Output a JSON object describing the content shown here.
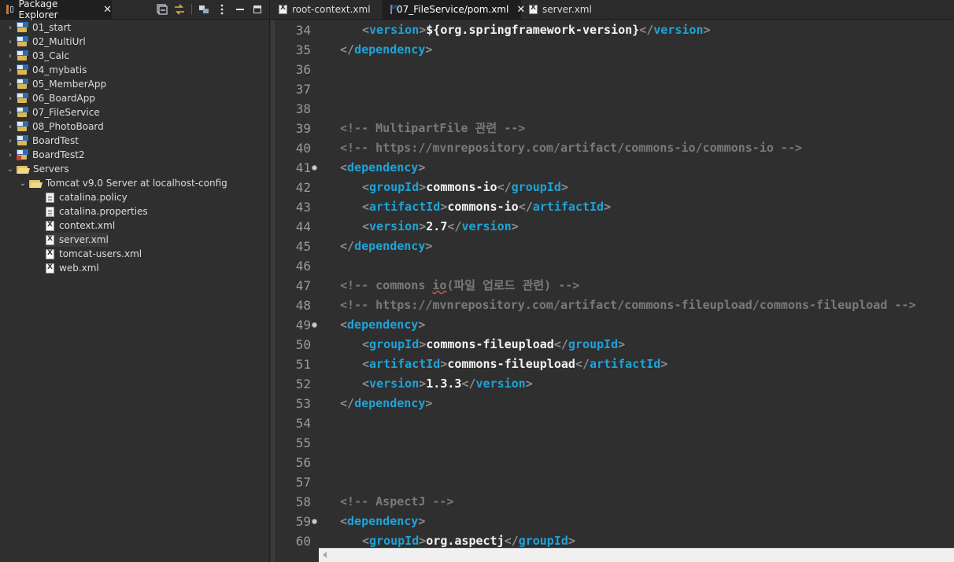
{
  "left_panel": {
    "view_title": "Package Explorer",
    "tree": [
      {
        "label": "01_start",
        "kind": "project"
      },
      {
        "label": "02_MultiUrl",
        "kind": "project"
      },
      {
        "label": "03_Calc",
        "kind": "project"
      },
      {
        "label": "04_mybatis",
        "kind": "project"
      },
      {
        "label": "05_MemberApp",
        "kind": "project"
      },
      {
        "label": "06_BoardApp",
        "kind": "project"
      },
      {
        "label": "07_FileService",
        "kind": "project"
      },
      {
        "label": "08_PhotoBoard",
        "kind": "project"
      },
      {
        "label": "BoardTest",
        "kind": "project"
      },
      {
        "label": "BoardTest2",
        "kind": "project-error"
      },
      {
        "label": "Servers",
        "kind": "folder"
      },
      {
        "label": "Tomcat v9.0 Server at localhost-config",
        "kind": "folder"
      },
      {
        "label": "catalina.policy",
        "kind": "file"
      },
      {
        "label": "catalina.properties",
        "kind": "file"
      },
      {
        "label": "context.xml",
        "kind": "xml"
      },
      {
        "label": "server.xml",
        "kind": "xml",
        "selected": true
      },
      {
        "label": "tomcat-users.xml",
        "kind": "xml"
      },
      {
        "label": "web.xml",
        "kind": "xml"
      }
    ]
  },
  "editor": {
    "tabs": [
      {
        "label": "root-context.xml",
        "icon": "xml-file-icon",
        "active": false
      },
      {
        "label": "07_FileService/pom.xml",
        "icon": "maven-pom-icon",
        "active": true
      },
      {
        "label": "server.xml",
        "icon": "xml-file-icon",
        "active": false
      }
    ],
    "lines": [
      {
        "num": "34",
        "fold": false,
        "indent": 4,
        "tokens": [
          {
            "t": "<",
            "c": "br"
          },
          {
            "t": "version",
            "c": "tag"
          },
          {
            "t": ">",
            "c": "br"
          },
          {
            "t": "${org.springframework-version}",
            "c": "text"
          },
          {
            "t": "</",
            "c": "br"
          },
          {
            "t": "version",
            "c": "tag"
          },
          {
            "t": ">",
            "c": "br"
          }
        ]
      },
      {
        "num": "35",
        "fold": false,
        "indent": 2,
        "tokens": [
          {
            "t": "</",
            "c": "br"
          },
          {
            "t": "dependency",
            "c": "tag"
          },
          {
            "t": ">",
            "c": "br"
          }
        ]
      },
      {
        "num": "36",
        "fold": false,
        "indent": 0,
        "tokens": []
      },
      {
        "num": "37",
        "fold": false,
        "indent": 0,
        "tokens": []
      },
      {
        "num": "38",
        "fold": false,
        "indent": 0,
        "tokens": []
      },
      {
        "num": "39",
        "fold": false,
        "indent": 2,
        "tokens": [
          {
            "t": "<!-- MultipartFile 관련 -->",
            "c": "comment"
          }
        ]
      },
      {
        "num": "40",
        "fold": false,
        "indent": 2,
        "tokens": [
          {
            "t": "<!-- https://mvnrepository.com/artifact/commons-io/commons-io -->",
            "c": "comment"
          }
        ]
      },
      {
        "num": "41",
        "fold": true,
        "indent": 2,
        "tokens": [
          {
            "t": "<",
            "c": "br"
          },
          {
            "t": "dependency",
            "c": "tag"
          },
          {
            "t": ">",
            "c": "br"
          }
        ]
      },
      {
        "num": "42",
        "fold": false,
        "indent": 4,
        "tokens": [
          {
            "t": "<",
            "c": "br"
          },
          {
            "t": "groupId",
            "c": "tag"
          },
          {
            "t": ">",
            "c": "br"
          },
          {
            "t": "commons-io",
            "c": "text"
          },
          {
            "t": "</",
            "c": "br"
          },
          {
            "t": "groupId",
            "c": "tag"
          },
          {
            "t": ">",
            "c": "br"
          }
        ]
      },
      {
        "num": "43",
        "fold": false,
        "indent": 4,
        "tokens": [
          {
            "t": "<",
            "c": "br"
          },
          {
            "t": "artifactId",
            "c": "tag"
          },
          {
            "t": ">",
            "c": "br"
          },
          {
            "t": "commons-io",
            "c": "text"
          },
          {
            "t": "</",
            "c": "br"
          },
          {
            "t": "artifactId",
            "c": "tag"
          },
          {
            "t": ">",
            "c": "br"
          }
        ]
      },
      {
        "num": "44",
        "fold": false,
        "indent": 4,
        "tokens": [
          {
            "t": "<",
            "c": "br"
          },
          {
            "t": "version",
            "c": "tag"
          },
          {
            "t": ">",
            "c": "br"
          },
          {
            "t": "2.7",
            "c": "text"
          },
          {
            "t": "</",
            "c": "br"
          },
          {
            "t": "version",
            "c": "tag"
          },
          {
            "t": ">",
            "c": "br"
          }
        ]
      },
      {
        "num": "45",
        "fold": false,
        "indent": 2,
        "tokens": [
          {
            "t": "</",
            "c": "br"
          },
          {
            "t": "dependency",
            "c": "tag"
          },
          {
            "t": ">",
            "c": "br"
          }
        ]
      },
      {
        "num": "46",
        "fold": false,
        "indent": 0,
        "tokens": []
      },
      {
        "num": "47",
        "fold": false,
        "indent": 2,
        "tokens": [
          {
            "t": "<!-- commons ",
            "c": "comment"
          },
          {
            "t": "io",
            "c": "comment-squiggle"
          },
          {
            "t": "(파일 업로드 관련) -->",
            "c": "comment"
          }
        ]
      },
      {
        "num": "48",
        "fold": false,
        "indent": 2,
        "tokens": [
          {
            "t": "<!-- https://mvnrepository.com/artifact/commons-fileupload/commons-fileupload -->",
            "c": "comment"
          }
        ]
      },
      {
        "num": "49",
        "fold": true,
        "indent": 2,
        "tokens": [
          {
            "t": "<",
            "c": "br"
          },
          {
            "t": "dependency",
            "c": "tag"
          },
          {
            "t": ">",
            "c": "br"
          }
        ]
      },
      {
        "num": "50",
        "fold": false,
        "indent": 4,
        "tokens": [
          {
            "t": "<",
            "c": "br"
          },
          {
            "t": "groupId",
            "c": "tag"
          },
          {
            "t": ">",
            "c": "br"
          },
          {
            "t": "commons-fileupload",
            "c": "text"
          },
          {
            "t": "</",
            "c": "br"
          },
          {
            "t": "groupId",
            "c": "tag"
          },
          {
            "t": ">",
            "c": "br"
          }
        ]
      },
      {
        "num": "51",
        "fold": false,
        "indent": 4,
        "tokens": [
          {
            "t": "<",
            "c": "br"
          },
          {
            "t": "artifactId",
            "c": "tag"
          },
          {
            "t": ">",
            "c": "br"
          },
          {
            "t": "commons-fileupload",
            "c": "text"
          },
          {
            "t": "</",
            "c": "br"
          },
          {
            "t": "artifactId",
            "c": "tag"
          },
          {
            "t": ">",
            "c": "br"
          }
        ]
      },
      {
        "num": "52",
        "fold": false,
        "indent": 4,
        "tokens": [
          {
            "t": "<",
            "c": "br"
          },
          {
            "t": "version",
            "c": "tag"
          },
          {
            "t": ">",
            "c": "br"
          },
          {
            "t": "1.3.3",
            "c": "text"
          },
          {
            "t": "</",
            "c": "br"
          },
          {
            "t": "version",
            "c": "tag"
          },
          {
            "t": ">",
            "c": "br"
          }
        ]
      },
      {
        "num": "53",
        "fold": false,
        "indent": 2,
        "tokens": [
          {
            "t": "</",
            "c": "br"
          },
          {
            "t": "dependency",
            "c": "tag"
          },
          {
            "t": ">",
            "c": "br"
          }
        ]
      },
      {
        "num": "54",
        "fold": false,
        "indent": 0,
        "tokens": []
      },
      {
        "num": "55",
        "fold": false,
        "indent": 0,
        "tokens": []
      },
      {
        "num": "56",
        "fold": false,
        "indent": 0,
        "tokens": []
      },
      {
        "num": "57",
        "fold": false,
        "indent": 0,
        "tokens": []
      },
      {
        "num": "58",
        "fold": false,
        "indent": 2,
        "tokens": [
          {
            "t": "<!-- AspectJ -->",
            "c": "comment"
          }
        ]
      },
      {
        "num": "59",
        "fold": true,
        "indent": 2,
        "tokens": [
          {
            "t": "<",
            "c": "br"
          },
          {
            "t": "dependency",
            "c": "tag"
          },
          {
            "t": ">",
            "c": "br"
          }
        ]
      },
      {
        "num": "60",
        "fold": false,
        "indent": 4,
        "tokens": [
          {
            "t": "<",
            "c": "br"
          },
          {
            "t": "groupId",
            "c": "tag"
          },
          {
            "t": ">",
            "c": "br"
          },
          {
            "t": "org.aspectj",
            "c": "text"
          },
          {
            "t": "</",
            "c": "br"
          },
          {
            "t": "groupId",
            "c": "tag"
          },
          {
            "t": ">",
            "c": "br"
          }
        ]
      }
    ]
  },
  "colors": {
    "tag": "#1fa3d8",
    "comment": "#7a7a7a",
    "text": "#f4f4f4",
    "background": "#2f2f2f"
  }
}
